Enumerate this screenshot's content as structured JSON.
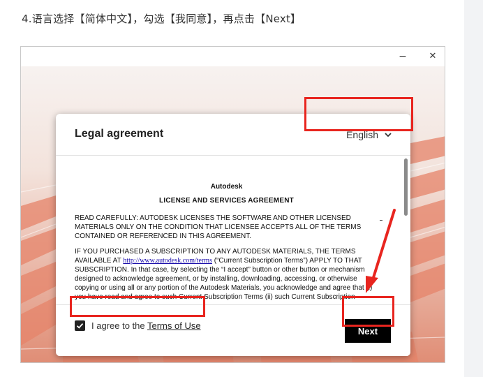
{
  "step_instruction": "4.语言选择【简体中文】，勾选【我同意】，再点击【Next】",
  "window_controls": {
    "minimize": "−",
    "close": "✕"
  },
  "dialog": {
    "title": "Legal agreement",
    "language_selected": "English",
    "agreement": {
      "company": "Autodesk",
      "heading": "LICENSE AND SERVICES AGREEMENT",
      "para1": "READ CAREFULLY:  AUTODESK LICENSES THE SOFTWARE AND OTHER LICENSED MATERIALS ONLY ON THE CONDITION THAT LICENSEE ACCEPTS ALL OF THE TERMS CONTAINED OR REFERENCED IN THIS AGREEMENT.",
      "para2_start": "IF YOU PURCHASED A SUBSCRIPTION TO ANY AUTODESK MATERIALS, THE TERMS AVAILABLE AT ",
      "para2_link": "http://www.autodesk.com/terms",
      "para2_end": " (“Current Subscription Terms”) APPLY TO THAT SUBSCRIPTION.  In that case, by selecting the “I accept” button or other button or mechanism designed to acknowledge agreement, or by installing, downloading, accessing, or otherwise copying or using all or any portion of the Autodesk Materials, you acknowledge and agree that (i) you have read and agree to such Current Subscription Terms (ii) such Current Subscription"
    },
    "agree_label": "I agree to the ",
    "terms_link": "Terms of Use",
    "agree_checked": true,
    "next_button": "Next"
  },
  "colors": {
    "highlight": "#e8251f",
    "button": "#000000"
  }
}
